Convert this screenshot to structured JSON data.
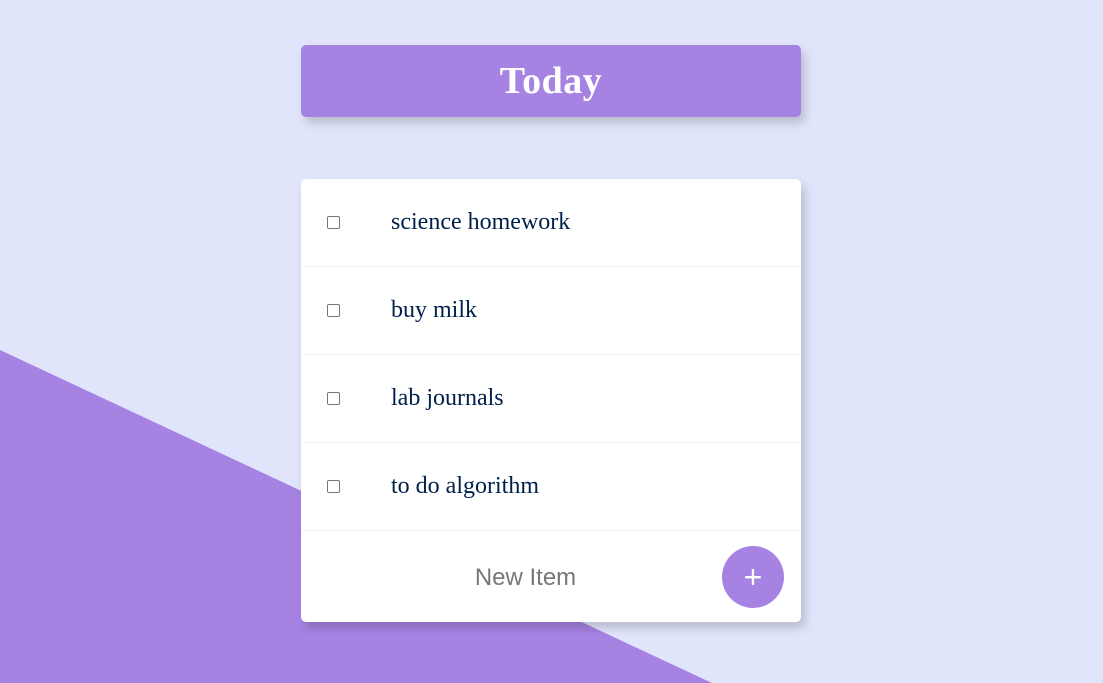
{
  "page": {
    "title": "Today"
  },
  "items": [
    {
      "label": "science homework",
      "checked": false
    },
    {
      "label": "buy milk",
      "checked": false
    },
    {
      "label": "lab journals",
      "checked": false
    },
    {
      "label": "to do algorithm",
      "checked": false
    }
  ],
  "new_item": {
    "placeholder": "New Item",
    "add_label": "+"
  },
  "colors": {
    "background": "#E1E5FC",
    "accent": "#A683E3",
    "item_text": "#00204A",
    "card": "#FFFFFF"
  }
}
